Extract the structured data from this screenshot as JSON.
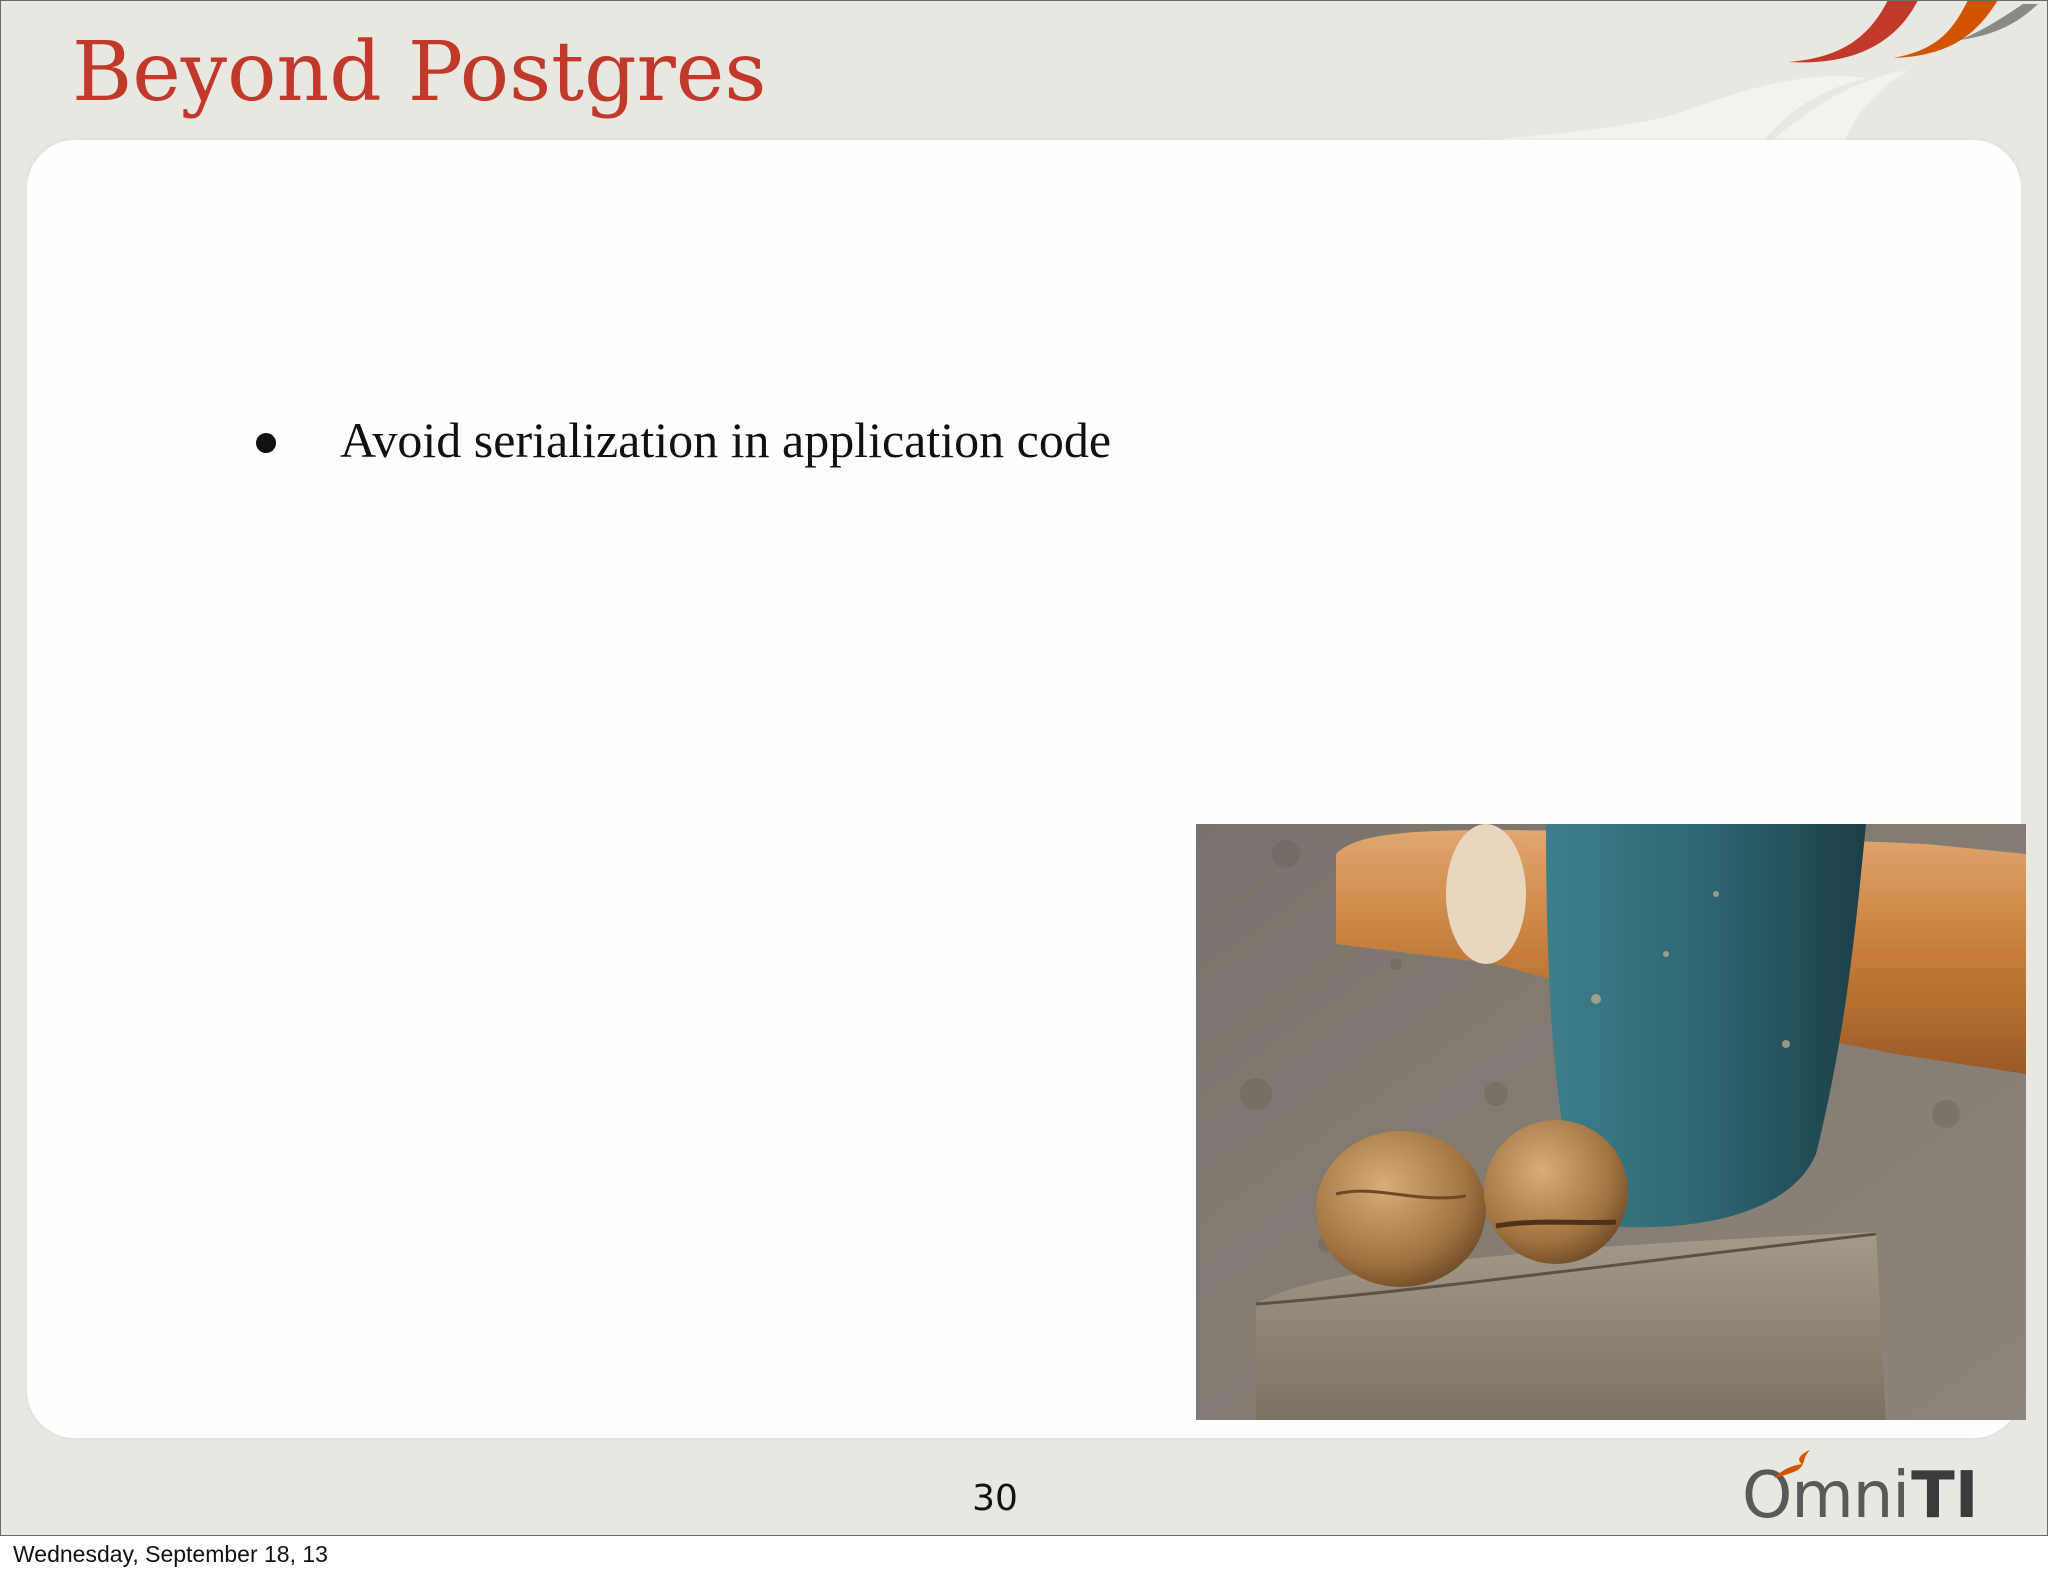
{
  "slide": {
    "title": "Beyond Postgres",
    "bullets": [
      "Avoid serialization in application code"
    ],
    "image_description": "hammer-and-walnuts-photo",
    "page_number": "30",
    "logo": {
      "text_omni": "Omni",
      "text_ti": "TI"
    }
  },
  "footer": {
    "date": "Wednesday, September 18, 13"
  },
  "colors": {
    "title": "#c0392b",
    "background": "#e9e8e0",
    "panel": "#fefefe",
    "accent_red": "#c0392b",
    "accent_orange": "#d35400",
    "accent_grey": "#7f8c8d"
  }
}
